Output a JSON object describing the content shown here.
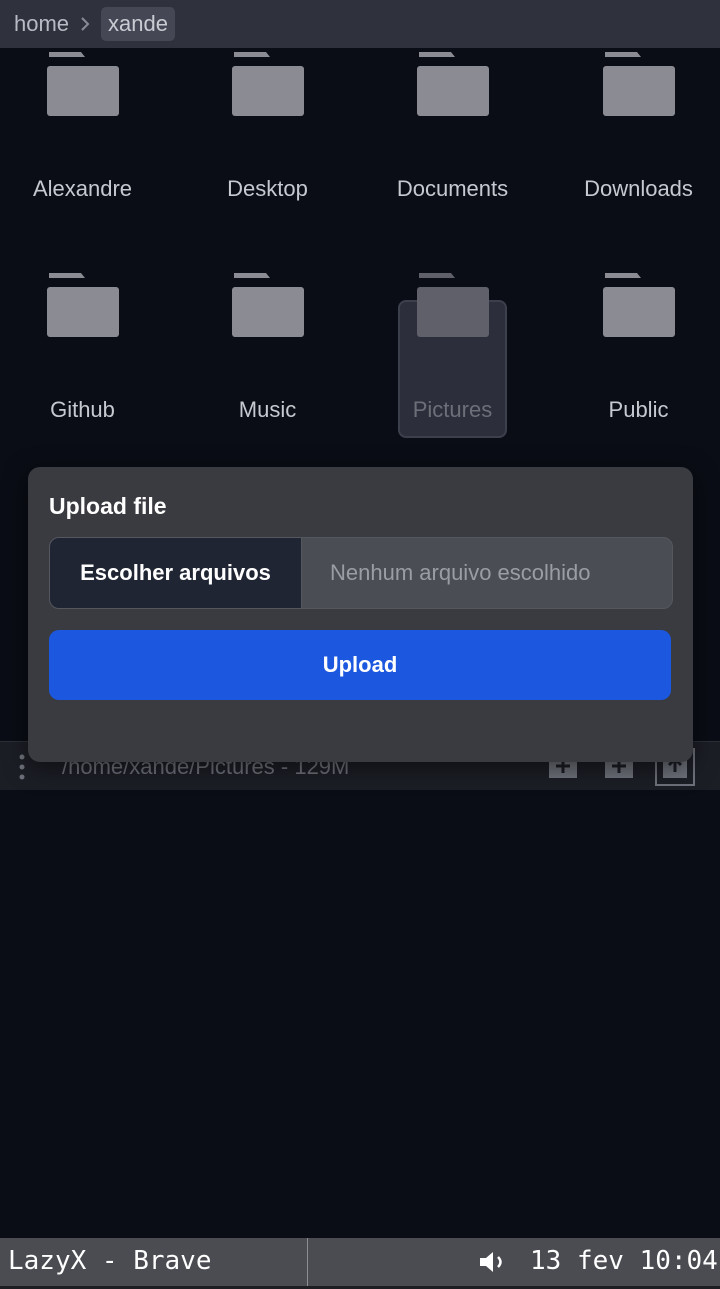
{
  "breadcrumb": {
    "items": [
      "home",
      "xande"
    ]
  },
  "folders": [
    {
      "name": "Alexandre"
    },
    {
      "name": "Desktop"
    },
    {
      "name": "Documents"
    },
    {
      "name": "Downloads"
    },
    {
      "name": "Github"
    },
    {
      "name": "Music"
    },
    {
      "name": "Pictures",
      "selected": true
    },
    {
      "name": "Public"
    }
  ],
  "path_bar": {
    "text": "/home/xande/Pictures - 129M"
  },
  "dialog": {
    "title": "Upload file",
    "choose_label": "Escolher arquivos",
    "no_file_text": "Nenhum arquivo escolhido",
    "upload_label": "Upload"
  },
  "taskbar": {
    "window_title": "LazyX - Brave",
    "clock": "13 fev 10:04"
  },
  "colors": {
    "background": "#0a0d15",
    "accent": "#1c57e0",
    "folder": "#8a8b93"
  }
}
